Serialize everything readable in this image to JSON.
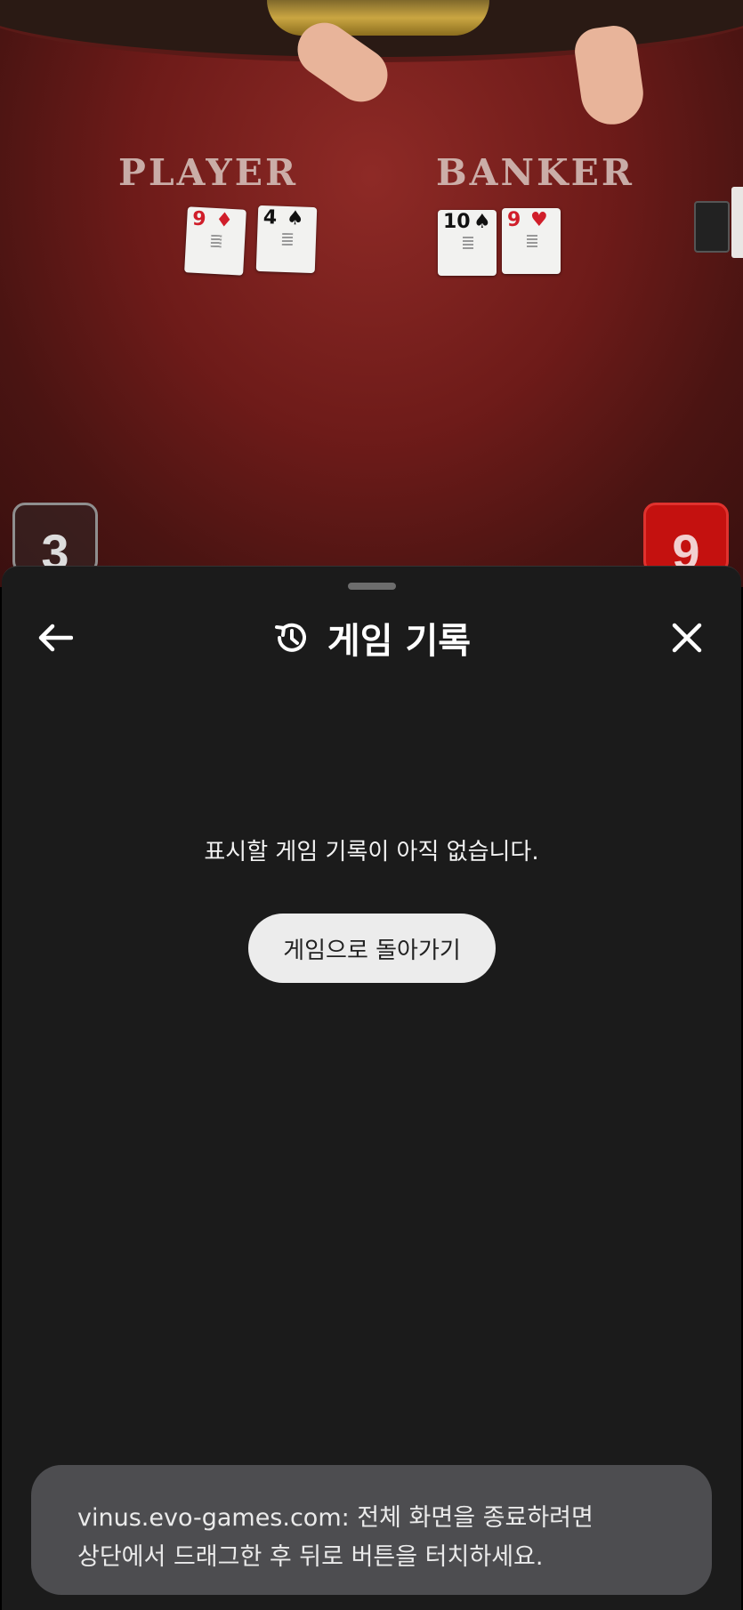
{
  "game": {
    "player_label": "PLAYER",
    "banker_label": "BANKER",
    "player_cards": [
      {
        "rank": "9",
        "suit": "♦",
        "color": "red"
      },
      {
        "rank": "4",
        "suit": "♠",
        "color": "black"
      }
    ],
    "banker_cards": [
      {
        "rank": "10",
        "suit": "♠",
        "color": "black"
      },
      {
        "rank": "9",
        "suit": "♥",
        "color": "red"
      }
    ],
    "player_score": "3",
    "banker_score": "9"
  },
  "sheet": {
    "title": "게임 기록",
    "title_icon": "history-icon",
    "back_icon": "arrow-left-icon",
    "close_icon": "close-icon",
    "empty_message": "표시할 게임 기록이 아직 없습니다.",
    "return_button_label": "게임으로 돌아가기"
  },
  "toast": {
    "line1": "vinus.evo-games.com: 전체 화면을 종료하려면",
    "line2": "상단에서 드래그한 후 뒤로 버튼을 터치하세요."
  },
  "colors": {
    "sheet_bg": "#1b1b1b",
    "banker_score_bg": "#c4110f",
    "toast_bg": "#4d4d50"
  }
}
